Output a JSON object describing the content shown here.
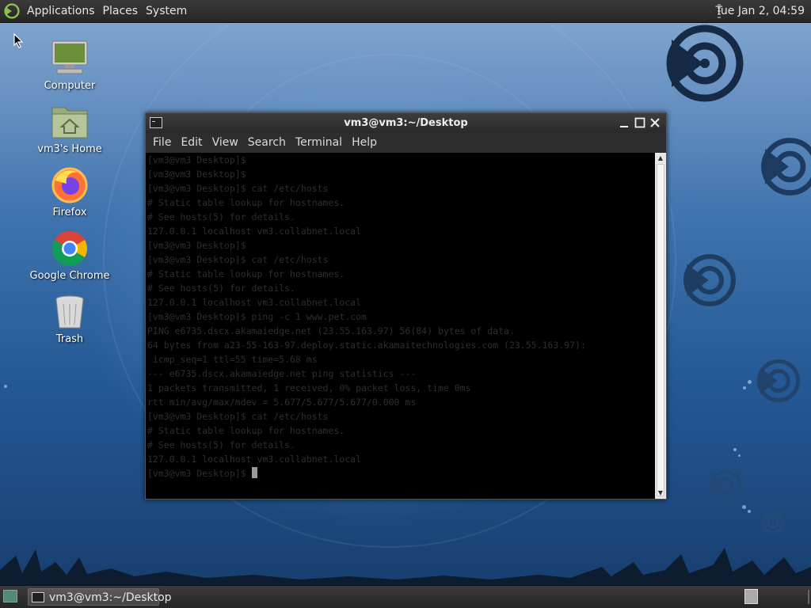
{
  "top_panel": {
    "menus": [
      "Applications",
      "Places",
      "System"
    ],
    "clock": "Tue Jan  2, 04:59"
  },
  "desktop": {
    "icons": [
      {
        "label": "Computer",
        "icon": "computer-icon"
      },
      {
        "label": "vm3's Home",
        "icon": "home-folder-icon"
      },
      {
        "label": "Firefox",
        "icon": "firefox-icon"
      },
      {
        "label": "Google Chrome",
        "icon": "chrome-icon"
      },
      {
        "label": "Trash",
        "icon": "trash-icon"
      }
    ]
  },
  "terminal": {
    "title": "vm3@vm3:~/Desktop",
    "menus": [
      "File",
      "Edit",
      "View",
      "Search",
      "Terminal",
      "Help"
    ],
    "lines": [
      "[vm3@vm3 Desktop]$",
      "[vm3@vm3 Desktop]$",
      "[vm3@vm3 Desktop]$ cat /etc/hosts",
      "# Static table lookup for hostnames.",
      "# See hosts(5) for details.",
      "127.0.0.1 localhost vm3.collabnet.local",
      "[vm3@vm3 Desktop]$",
      "[vm3@vm3 Desktop]$ cat /etc/hosts",
      "# Static table lookup for hostnames.",
      "# See hosts(5) for details.",
      "127.0.0.1 localhost vm3.collabnet.local",
      "[vm3@vm3 Desktop]$ ping -c 1 www.pet.com",
      "PING e6735.dscx.akamaiedge.net (23.55.163.97) 56(84) bytes of data.",
      "64 bytes from a23-55-163-97.deploy.static.akamaitechnologies.com (23.55.163.97):",
      " icmp_seq=1 ttl=55 time=5.68 ms",
      "",
      "--- e6735.dscx.akamaiedge.net ping statistics ---",
      "1 packets transmitted, 1 received, 0% packet loss, time 0ms",
      "rtt min/avg/max/mdev = 5.677/5.677/5.677/0.000 ms",
      "[vm3@vm3 Desktop]$ cat /etc/hosts",
      "# Static table lookup for hostnames.",
      "# See hosts(5) for details.",
      "127.0.0.1 localhost vm3.collabnet.local",
      "[vm3@vm3 Desktop]$ "
    ]
  },
  "taskbar": {
    "task_label": "vm3@vm3:~/Desktop"
  },
  "colors": {
    "panel": "#2f2f2f",
    "terminal_bg": "#000000",
    "terminal_text": "#2e2e2e",
    "wallpaper": "#2a5a96"
  }
}
